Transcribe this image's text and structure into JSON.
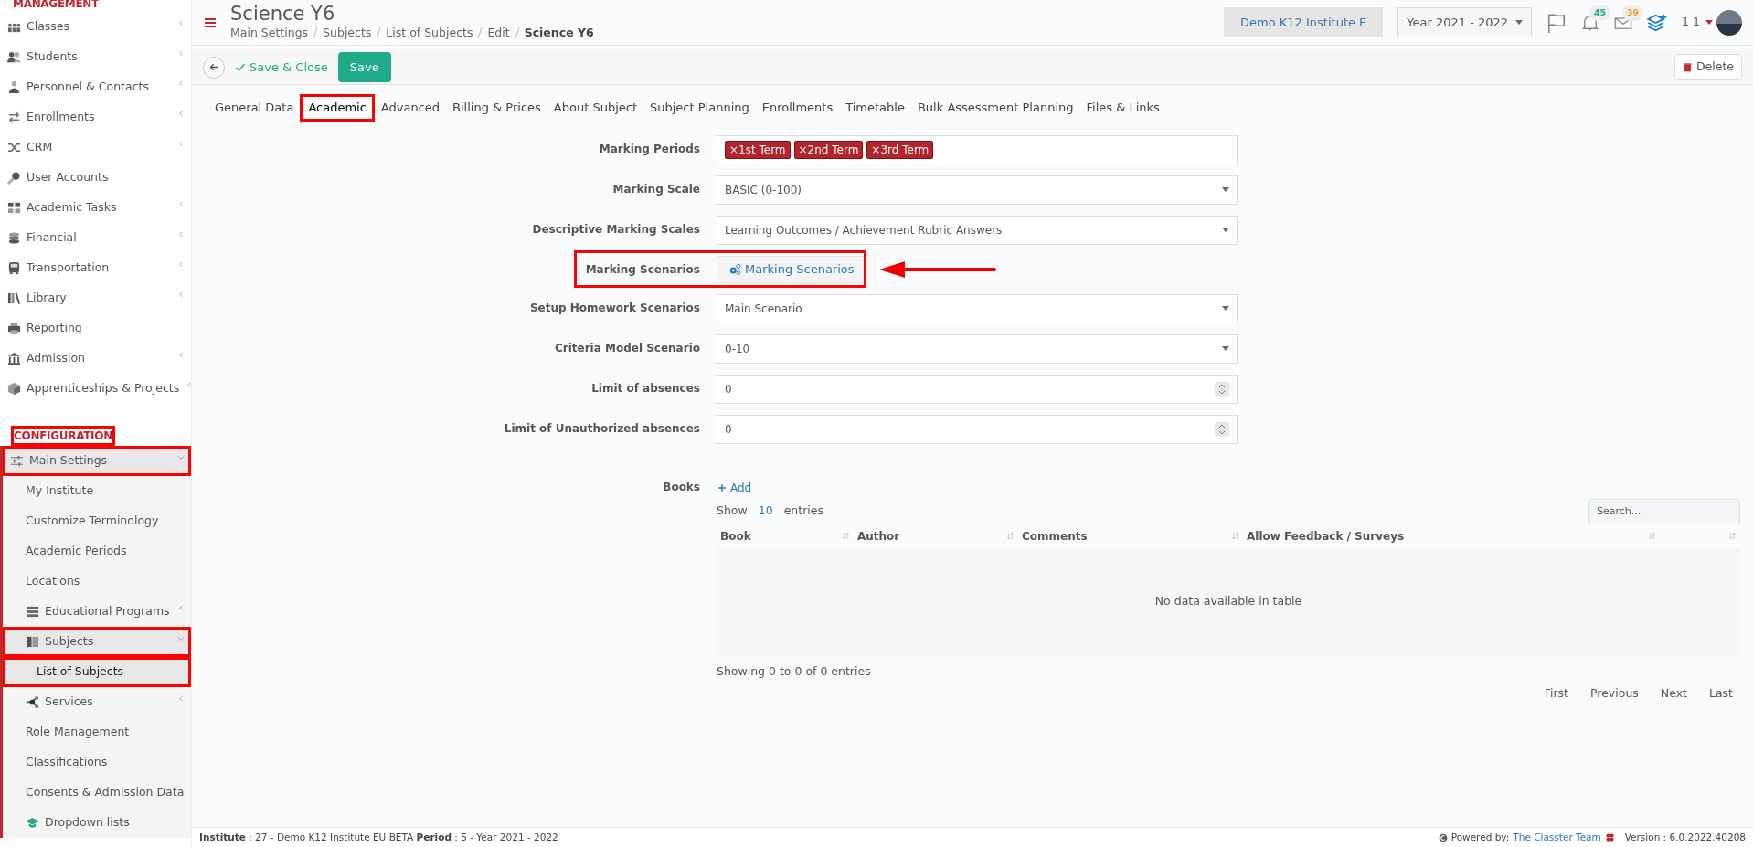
{
  "sidebar": {
    "sections": [
      {
        "title": "MANAGEMENT",
        "highlighted": false,
        "items": [
          {
            "label": "Classes",
            "has_submenu": true
          },
          {
            "label": "Students",
            "has_submenu": true
          },
          {
            "label": "Personnel & Contacts",
            "has_submenu": true
          },
          {
            "label": "Enrollments",
            "has_submenu": true
          },
          {
            "label": "CRM",
            "has_submenu": true
          },
          {
            "label": "User Accounts",
            "has_submenu": false
          },
          {
            "label": "Academic Tasks",
            "has_submenu": true
          },
          {
            "label": "Financial",
            "has_submenu": true
          },
          {
            "label": "Transportation",
            "has_submenu": true
          },
          {
            "label": "Library",
            "has_submenu": true
          },
          {
            "label": "Reporting",
            "has_submenu": false
          },
          {
            "label": "Admission",
            "has_submenu": true
          },
          {
            "label": "Apprenticeships & Projects",
            "has_submenu": true
          }
        ]
      },
      {
        "title": "CONFIGURATION",
        "highlighted": true,
        "items": [
          {
            "label": "Main Settings",
            "has_submenu": true,
            "expanded": true,
            "highlighted": true,
            "children": [
              {
                "label": "My Institute",
                "has_submenu": false
              },
              {
                "label": "Customize Terminology",
                "has_submenu": false
              },
              {
                "label": "Academic Periods",
                "has_submenu": false
              },
              {
                "label": "Locations",
                "has_submenu": false
              },
              {
                "label": "Educational Programs",
                "has_submenu": true,
                "expanded": false
              },
              {
                "label": "Subjects",
                "has_submenu": true,
                "expanded": true,
                "highlighted": true,
                "children": [
                  {
                    "label": "List of Subjects",
                    "selected": true,
                    "highlighted": true
                  }
                ]
              },
              {
                "label": "Services",
                "has_submenu": true,
                "expanded": false
              },
              {
                "label": "Role Management",
                "has_submenu": false
              },
              {
                "label": "Classifications",
                "has_submenu": false
              },
              {
                "label": "Consents & Admission Data",
                "has_submenu": false
              },
              {
                "label": "Dropdown lists",
                "has_submenu": false
              }
            ]
          }
        ]
      }
    ]
  },
  "header": {
    "title": "Science Y6",
    "breadcrumb": [
      "Main Settings",
      "Subjects",
      "List of Subjects",
      "Edit",
      "Science Y6"
    ],
    "institute": "Demo K12 Institute E",
    "year": "Year 2021 - 2022",
    "notifications": "45",
    "messages": "39",
    "user": "1 1"
  },
  "toolbar": {
    "save_close": "Save & Close",
    "save": "Save",
    "delete": "Delete"
  },
  "tabs": [
    {
      "label": "General Data",
      "selected": false,
      "highlighted": false
    },
    {
      "label": "Academic",
      "selected": true,
      "highlighted": true
    },
    {
      "label": "Advanced",
      "selected": false,
      "highlighted": false
    },
    {
      "label": "Billing & Prices",
      "selected": false,
      "highlighted": false
    },
    {
      "label": "About Subject",
      "selected": false,
      "highlighted": false
    },
    {
      "label": "Subject Planning",
      "selected": false,
      "highlighted": false
    },
    {
      "label": "Enrollments",
      "selected": false,
      "highlighted": false
    },
    {
      "label": "Timetable",
      "selected": false,
      "highlighted": false
    },
    {
      "label": "Bulk Assessment Planning",
      "selected": false,
      "highlighted": false
    },
    {
      "label": "Files & Links",
      "selected": false,
      "highlighted": false
    }
  ],
  "form": [
    {
      "kind": "tags",
      "label": "Marking Periods",
      "tags": [
        "×1st Term",
        "×2nd Term",
        "×3rd Term"
      ]
    },
    {
      "kind": "select",
      "label": "Marking Scale",
      "value": "BASIC (0-100)"
    },
    {
      "kind": "select",
      "label": "Descriptive Marking Scales",
      "value": "Learning Outcomes / Achievement Rubric Answers"
    },
    {
      "kind": "button",
      "label": "Marking Scenarios",
      "value": "Marking Scenarios",
      "highlighted": true,
      "arrow": true
    },
    {
      "kind": "select",
      "label": "Setup Homework Scenarios",
      "value": "Main Scenario"
    },
    {
      "kind": "select",
      "label": "Criteria Model Scenario",
      "value": "0-10"
    },
    {
      "kind": "number",
      "label": "Limit of absences",
      "value": "0"
    },
    {
      "kind": "number",
      "label": "Limit of Unauthorized absences",
      "value": "0"
    }
  ],
  "books": {
    "label": "Books",
    "add": "Add",
    "show": "Show",
    "page_size": "10",
    "entries": "entries",
    "search_placeholder": "Search...",
    "columns": [
      "Book",
      "Author",
      "Comments",
      "Allow Feedback / Surveys"
    ],
    "empty": "No data available in table",
    "info": "Showing 0 to 0 of 0 entries",
    "pager": [
      "First",
      "Previous",
      "Next",
      "Last"
    ]
  },
  "footer": {
    "info": "**Institute** : 27 - Demo K12 Institute EU BETA **Period** : 5 - Year 2021 - 2022",
    "powered": "Powered by:",
    "team": "The Classter Team",
    "version": "| Version : 6.0.2022.40208"
  }
}
